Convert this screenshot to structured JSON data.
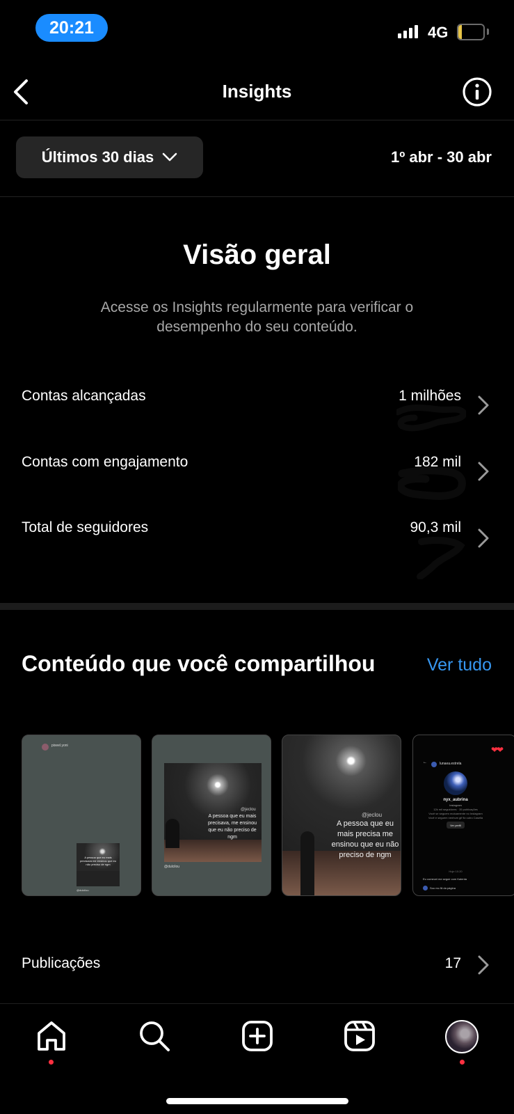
{
  "status_bar": {
    "time": "20:21",
    "network": "4G",
    "battery": "13",
    "battery_percent": 13
  },
  "header": {
    "title": "Insights"
  },
  "period": {
    "selector_label": "Últimos 30 dias",
    "date_range": "1º abr - 30 abr"
  },
  "overview": {
    "title": "Visão geral",
    "description": "Acesse os Insights regularmente para verificar o desempenho do seu conteúdo.",
    "metrics": [
      {
        "label": "Contas alcançadas",
        "value": "1 milhões"
      },
      {
        "label": "Contas com engajamento",
        "value": "182 mil"
      },
      {
        "label": "Total de seguidores",
        "value": "90,3 mil"
      }
    ]
  },
  "shared_content": {
    "title": "Conteúdo que você compartilhou",
    "see_all": "Ver tudo",
    "thumbnails": [
      {
        "kind": "gray-post",
        "username": "pixeel.yoni",
        "caption": "A pessoa que eu mais precisava me ensinou que eu não preciso de ngm",
        "footer": "@dulcilou"
      },
      {
        "kind": "moon-post",
        "handle": "@jeclou",
        "caption": "A pessoa que eu mais precisava, me ensinou que eu não preciso de ngm",
        "footer": "@dulcilou"
      },
      {
        "kind": "moon-story",
        "handle": "@jeclou",
        "caption": "A pessoa que eu mais precisa me ensinou que eu não preciso de ngm"
      },
      {
        "kind": "profile-story",
        "header": "lunaea.estrela",
        "profile_name": "nyx_aubrina",
        "profile_sub": "Instagram",
        "lines": [
          "12k mil seguidores · 35 publicações",
          "Você se seguem mutuamente no Instagram",
          "Você e seguem nenhum gif fiz outro Casella"
        ],
        "button": "Ver perfil",
        "date": "Hoje 10:20",
        "msg1": "Eu comecei me seguir com Kalenta",
        "msg2": "Sou mo fã da página"
      }
    ]
  },
  "publications": {
    "label": "Publicações",
    "value": "17"
  },
  "tabbar": {
    "icons": [
      "home-icon",
      "search-icon",
      "create-icon",
      "reels-icon",
      "profile-avatar"
    ],
    "badges": {
      "home": true,
      "profile": true
    }
  },
  "colors": {
    "accent": "#3797f0",
    "time_pill": "#1a8cff",
    "notification_dot": "#ff3040",
    "battery": "#e8c547"
  }
}
